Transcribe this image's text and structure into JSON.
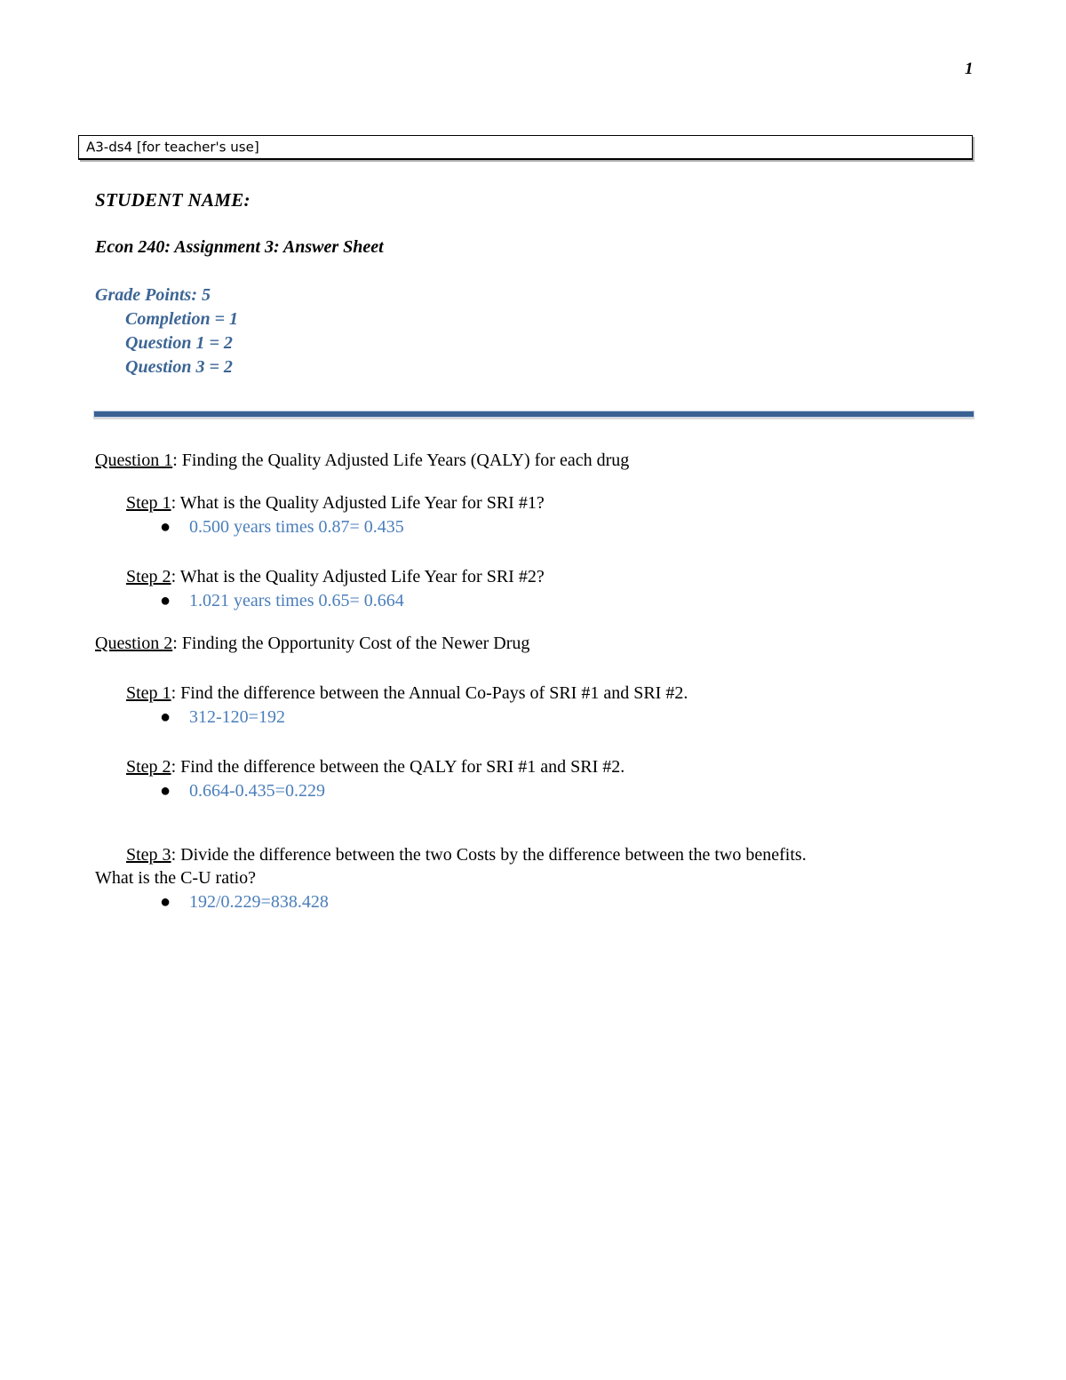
{
  "page": {
    "page_number": "1"
  },
  "teacher_box": {
    "label": "A3-ds4 [for teacher's use]"
  },
  "header": {
    "student_name_label": "STUDENT NAME:",
    "course_line": "Econ 240: Assignment 3: Answer Sheet",
    "grade_points_title": "Grade Points: 5",
    "grade_points_items": [
      "Completion = 1",
      "Question 1 = 2",
      "Question 3 = 2"
    ],
    "grade_color": "#3C6595",
    "divider_color": "#3A6193"
  },
  "answer_color": "#4A7EBB",
  "questions": [
    {
      "label": "Question 1",
      "title": ": Finding the Quality Adjusted Life Years (QALY) for each drug",
      "steps": [
        {
          "label": "Step 1",
          "prompt": ": What is the Quality Adjusted Life Year for SRI #1?",
          "answers": [
            "0.500 years times 0.87= 0.435"
          ]
        },
        {
          "label": "Step 2",
          "prompt": ": What is the Quality Adjusted Life Year for SRI #2?",
          "answers": [
            "1.021 years times 0.65= 0.664"
          ]
        }
      ]
    },
    {
      "label": "Question 2",
      "title": ": Finding the Opportunity Cost of the Newer Drug",
      "steps": [
        {
          "label": "Step 1",
          "prompt": ": Find the difference between the Annual Co-Pays of SRI #1 and SRI #2.",
          "answers": [
            "312-120=192"
          ]
        },
        {
          "label": "Step 2",
          "prompt": ": Find the difference between the QALY for SRI #1 and SRI #2.",
          "answers": [
            "0.664-0.435=0.229"
          ]
        },
        {
          "label": "Step 3",
          "prompt": ": Divide the difference between the two Costs by the difference between the two benefits.",
          "prompt_tail": "What is the C-U ratio?",
          "answers": [
            "192/0.229=838.428"
          ]
        }
      ]
    }
  ],
  "bullet_glyph": "●"
}
